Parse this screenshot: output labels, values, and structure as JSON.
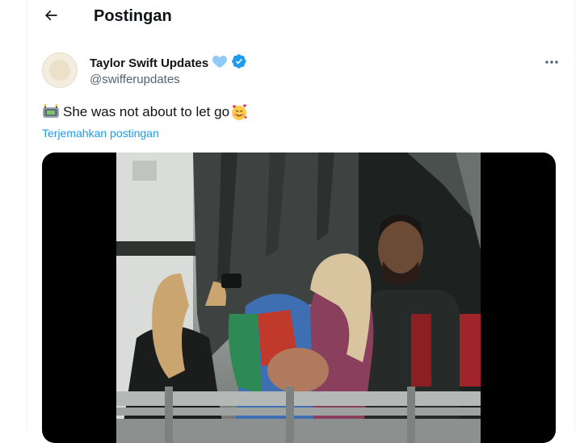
{
  "header": {
    "title": "Postingan"
  },
  "post": {
    "display_name": "Taylor Swift Updates",
    "handle": "@swifferupdates",
    "text": "She was not about to let go",
    "translate_label": "Terjemahkan postingan"
  },
  "icons": {
    "back": "arrow-left-icon",
    "heart": "light-blue-heart-emoji",
    "verified": "verified-badge-icon",
    "more": "more-horizontal-icon",
    "stadium": "stadium-emoji",
    "smiling_hearts": "smiling-face-with-hearts-emoji"
  },
  "colors": {
    "accent": "#1d9bf0",
    "secondary_text": "#536471",
    "heart": "#8ecbf7"
  }
}
